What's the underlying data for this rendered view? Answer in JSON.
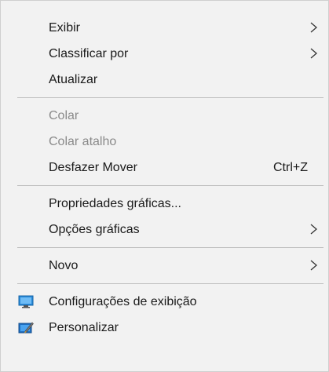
{
  "menu": {
    "items": [
      {
        "label": "Exibir",
        "submenu": true
      },
      {
        "label": "Classificar por",
        "submenu": true
      },
      {
        "label": "Atualizar"
      },
      {
        "label": "Colar",
        "disabled": true
      },
      {
        "label": "Colar atalho",
        "disabled": true
      },
      {
        "label": "Desfazer Mover",
        "shortcut": "Ctrl+Z"
      },
      {
        "label": "Propriedades gráficas..."
      },
      {
        "label": "Opções gráficas",
        "submenu": true
      },
      {
        "label": "Novo",
        "submenu": true
      },
      {
        "label": "Configurações de exibição",
        "icon": "display-settings-icon"
      },
      {
        "label": "Personalizar",
        "icon": "personalize-icon"
      }
    ]
  },
  "colors": {
    "menu_background": "#f2f2f2",
    "separator": "#bdbdbd",
    "disabled_text": "#8a8a8a",
    "text": "#1a1a1a",
    "icon_blue": "#1e88e5"
  }
}
